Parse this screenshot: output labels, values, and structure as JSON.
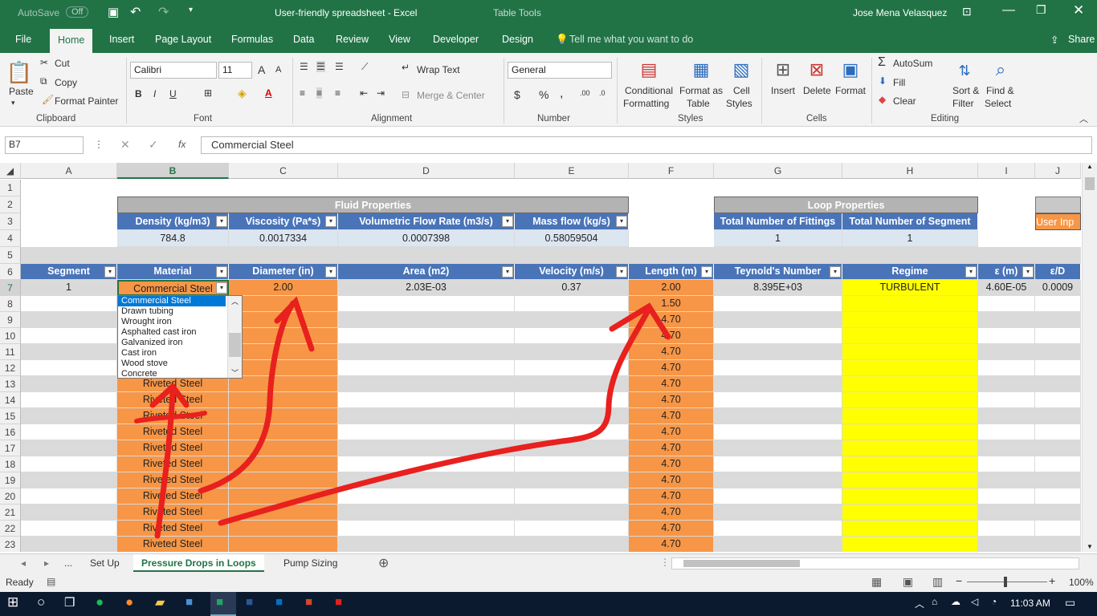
{
  "window": {
    "autosave_label": "AutoSave",
    "autosave_state": "Off",
    "title": "User-friendly spreadsheet  -  Excel",
    "context_tools": "Table Tools",
    "user": "Jose Mena Velasquez"
  },
  "tabs": [
    "File",
    "Home",
    "Insert",
    "Page Layout",
    "Formulas",
    "Data",
    "Review",
    "View",
    "Developer",
    "Design"
  ],
  "tell_me": "Tell me what you want to do",
  "share": "Share",
  "ribbon": {
    "clipboard": {
      "paste": "Paste",
      "cut": "Cut",
      "copy": "Copy",
      "format_painter": "Format Painter",
      "label": "Clipboard"
    },
    "font": {
      "name": "Calibri",
      "size": "11",
      "bold": "B",
      "italic": "I",
      "underline": "U",
      "label": "Font",
      "grow": "A",
      "shrink": "A"
    },
    "alignment": {
      "wrap": "Wrap Text",
      "merge": "Merge & Center",
      "label": "Alignment"
    },
    "number": {
      "format": "General",
      "currency": "$",
      "percent": "%",
      "comma": ",",
      "label": "Number"
    },
    "styles": {
      "conditional": "Conditional",
      "conditional2": "Formatting",
      "format_table": "Format as",
      "format_table2": "Table",
      "cell_styles": "Cell",
      "cell_styles2": "Styles",
      "label": "Styles"
    },
    "cells": {
      "insert": "Insert",
      "delete": "Delete",
      "format": "Format",
      "label": "Cells"
    },
    "editing": {
      "autosum": "AutoSum",
      "fill": "Fill",
      "clear": "Clear",
      "sort": "Sort &",
      "sort2": "Filter",
      "find": "Find &",
      "find2": "Select",
      "label": "Editing"
    }
  },
  "formula_bar": {
    "name_box": "B7",
    "fx": "fx",
    "value": "Commercial Steel"
  },
  "columns": [
    "A",
    "B",
    "C",
    "D",
    "E",
    "F",
    "G",
    "H",
    "I",
    "J"
  ],
  "rows": [
    "1",
    "2",
    "3",
    "4",
    "5",
    "6",
    "7",
    "8",
    "9",
    "10",
    "11",
    "12",
    "13",
    "14",
    "15",
    "16",
    "17",
    "18",
    "19",
    "20",
    "21",
    "22",
    "23"
  ],
  "fluid": {
    "title": "Fluid Properties",
    "headers": [
      "Density (kg/m3)",
      "Viscosity (Pa*s)",
      "Volumetric Flow Rate (m3/s)",
      "Mass flow (kg/s)"
    ],
    "values": [
      "784.8",
      "0.0017334",
      "0.0007398",
      "0.58059504"
    ]
  },
  "loop": {
    "title": "Loop Properties",
    "headers": [
      "Total Number of Fittings",
      "Total Number of Segment"
    ],
    "values": [
      "1",
      "1"
    ]
  },
  "user_input": "User Inp",
  "table_headers": [
    "Segment",
    "Material",
    "Diameter (in)",
    "Area (m2)",
    "Velocity (m/s)",
    "Length (m)",
    "Teynold's Number",
    "Regime",
    "ε (m)",
    "ε/D"
  ],
  "row7": [
    "1",
    "Commercial Steel",
    "2.00",
    "2.03E-03",
    "0.37",
    "2.00",
    "8.395E+03",
    "TURBULENT",
    "4.60E-05",
    "0.0009"
  ],
  "material_rest": "Riveted Steel",
  "lengths": [
    "1.50",
    "4.70",
    "4.70",
    "4.70",
    "4.70",
    "4.70",
    "4.70",
    "4.70",
    "4.70",
    "4.70",
    "4.70",
    "4.70",
    "4.70",
    "4.70",
    "4.70",
    "4.70"
  ],
  "dropdown": [
    "Commercial Steel",
    "Drawn tubing",
    "Wrought iron",
    "Asphalted cast iron",
    "Galvanized iron",
    "Cast iron",
    "Wood stove",
    "Concrete"
  ],
  "sheets": {
    "more": "...",
    "items": [
      "Set Up",
      "Pressure Drops in Loops",
      "Pump Sizing"
    ],
    "active": 1
  },
  "status": {
    "ready": "Ready",
    "zoom": "100%"
  },
  "taskbar": {
    "time": "11:03 AM"
  },
  "colors": {
    "excel_green": "#217346",
    "header_blue": "#4a74b8",
    "orange": "#f79646",
    "yellow": "#ffff00",
    "annotation": "#e8201e"
  }
}
